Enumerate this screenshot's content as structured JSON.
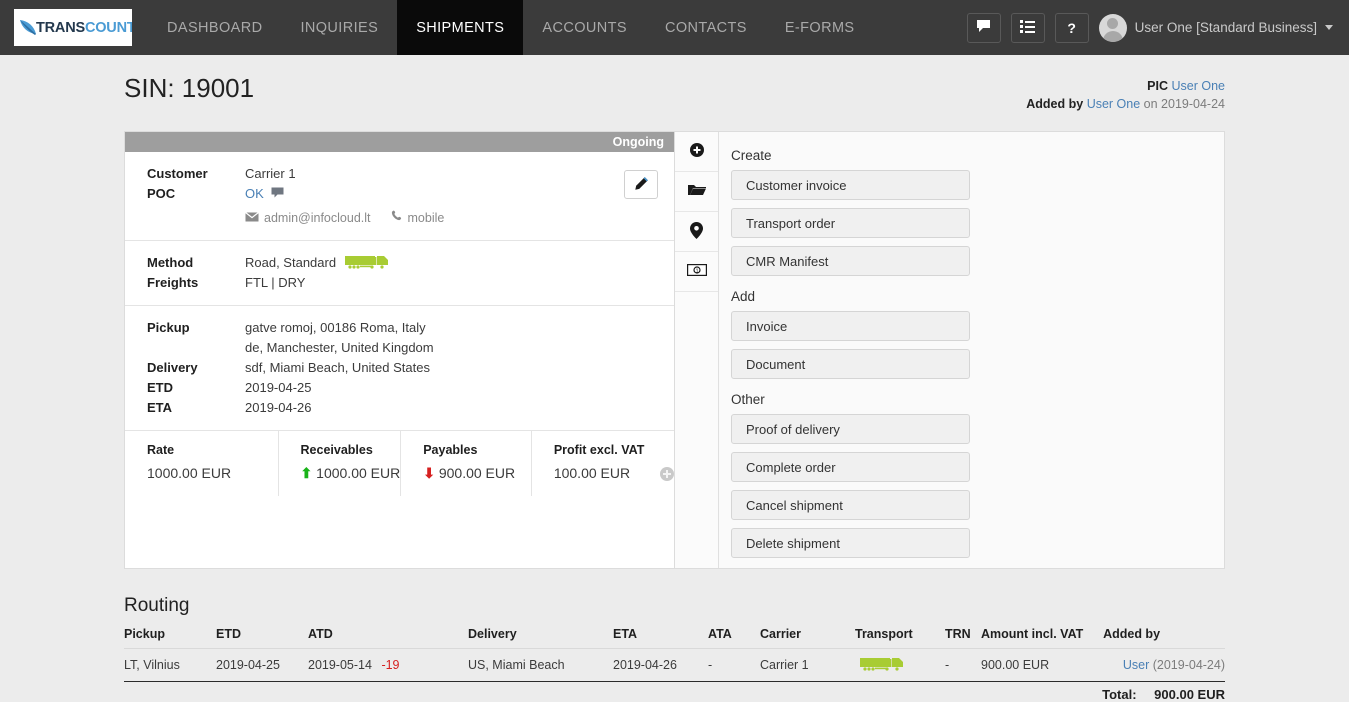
{
  "topnav": {
    "logo": {
      "part1": "TRANS",
      "part2": "COUNT"
    },
    "links": [
      {
        "label": "DASHBOARD",
        "active": false
      },
      {
        "label": "INQUIRIES",
        "active": false
      },
      {
        "label": "SHIPMENTS",
        "active": true
      },
      {
        "label": "ACCOUNTS",
        "active": false
      },
      {
        "label": "CONTACTS",
        "active": false
      },
      {
        "label": "E-FORMS",
        "active": false
      }
    ],
    "icons": [
      "chat-icon",
      "list-icon",
      "help-icon"
    ],
    "help_label": "?",
    "user": "User One [Standard Business]"
  },
  "header": {
    "title": "SIN: 19001",
    "pic_label": "PIC",
    "pic_value": "User One",
    "added_by_label": "Added by",
    "added_by_user": "User One",
    "added_by_on": "on 2019-04-24"
  },
  "shipment": {
    "status": "Ongoing",
    "customer_label": "Customer",
    "customer_value": "Carrier 1",
    "poc_label": "POC",
    "poc_value": "OK",
    "email": "admin@infocloud.lt",
    "phone": "mobile",
    "method_label": "Method",
    "method_value": "Road, Standard",
    "freights_label": "Freights",
    "freights_value": "FTL | DRY",
    "pickup_label": "Pickup",
    "pickup_line1": "gatve romoj, 00186 Roma, Italy",
    "pickup_line2": "de, Manchester, United Kingdom",
    "delivery_label": "Delivery",
    "delivery_value": "sdf, Miami Beach, United States",
    "etd_label": "ETD",
    "etd_value": "2019-04-25",
    "eta_label": "ETA",
    "eta_value": "2019-04-26",
    "financials": [
      {
        "label": "Rate",
        "value": "1000.00 EUR",
        "arrow": ""
      },
      {
        "label": "Receivables",
        "value": "1000.00 EUR",
        "arrow": "up"
      },
      {
        "label": "Payables",
        "value": "900.00 EUR",
        "arrow": "down"
      },
      {
        "label": "Profit excl. VAT",
        "value": "100.00 EUR",
        "arrow": ""
      }
    ]
  },
  "panel": {
    "rail_icons": [
      "plus-circle-icon",
      "folder-icon",
      "map-pin-icon",
      "money-icon"
    ],
    "groups": [
      {
        "title": "Create",
        "buttons": [
          "Customer invoice",
          "Transport order",
          "CMR Manifest"
        ]
      },
      {
        "title": "Add",
        "buttons": [
          "Invoice",
          "Document"
        ]
      },
      {
        "title": "Other",
        "buttons": [
          "Proof of delivery",
          "Complete order",
          "Cancel shipment",
          "Delete shipment"
        ]
      }
    ]
  },
  "routing": {
    "title": "Routing",
    "columns": [
      "Pickup",
      "ETD",
      "ATD",
      "Delivery",
      "ETA",
      "ATA",
      "Carrier",
      "Transport",
      "TRN",
      "Amount incl. VAT",
      "Added by"
    ],
    "rows": [
      {
        "pickup": "LT, Vilnius",
        "etd": "2019-04-25",
        "atd": "2019-05-14",
        "atd_delay": "-19",
        "delivery": "US, Miami Beach",
        "eta": "2019-04-26",
        "ata": "-",
        "carrier": "Carrier 1",
        "transport": "truck-icon",
        "trn": "-",
        "amount": "900.00 EUR",
        "added_by_user": "User",
        "added_by_date": "(2019-04-24)"
      }
    ],
    "total_label": "Total:",
    "total_value": "900.00 EUR"
  },
  "colors": {
    "nav_bg": "#3b3b3b",
    "nav_active_bg": "#0a0a0a",
    "status_bg": "#9e9e9e",
    "link": "#4a80b5",
    "truck_green": "#a8cc33",
    "arrow_up": "#19b319",
    "arrow_down": "#d62020"
  }
}
